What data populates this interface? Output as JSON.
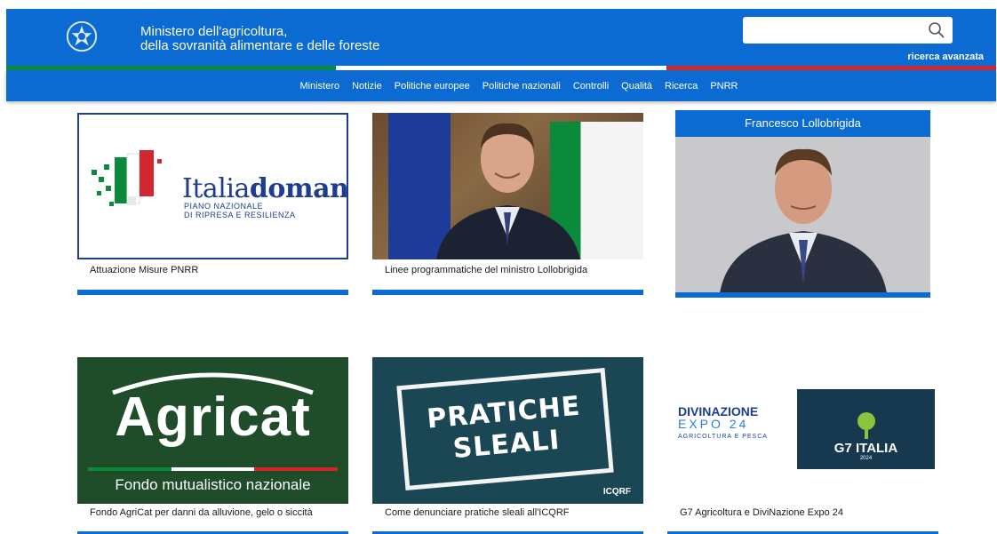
{
  "header": {
    "ministry_line1": "Ministero dell'agricoltura,",
    "ministry_line2": "della sovranità alimentare e delle foreste",
    "search_placeholder": "",
    "advanced_search": "ricerca avanzata"
  },
  "colors": {
    "brand_blue": "#0b6bd3",
    "flag_green": "#0a8a3a",
    "flag_red": "#d2272e"
  },
  "nav": {
    "items": [
      "Ministero",
      "Notizie",
      "Politiche europee",
      "Politiche nazionali",
      "Controlli",
      "Qualità",
      "Ricerca",
      "PNRR"
    ]
  },
  "cards": [
    {
      "caption": "Attuazione Misure PNRR",
      "logo_word_light": "Italia",
      "logo_word_bold": "domani",
      "logo_sub1": "PIANO NAZIONALE",
      "logo_sub2": "DI RIPRESA E RESILIENZA"
    },
    {
      "caption": "Linee programmatiche del ministro Lollobrigida"
    },
    {
      "title": "Francesco Lollobrigida"
    },
    {
      "caption": "Fondo AgriCat per danni da alluvione, gelo o siccità",
      "logo_word": "Agricat",
      "logo_sub": "Fondo mutualistico nazionale"
    },
    {
      "caption": "Come denunciare pratiche sleali all'ICQRF",
      "stamp_line1": "PRATICHE",
      "stamp_line2": "SLEALI",
      "brand": "ICQRF"
    },
    {
      "caption": "G7 Agricoltura e DiviNazione Expo 24",
      "divin_title": "DIVINAZIONE",
      "divin_expo": "EXPO 24",
      "divin_tag": "AGRICOLTURA E PESCA",
      "g7_text": "G7 ITALIA",
      "g7_year": "2024"
    }
  ]
}
